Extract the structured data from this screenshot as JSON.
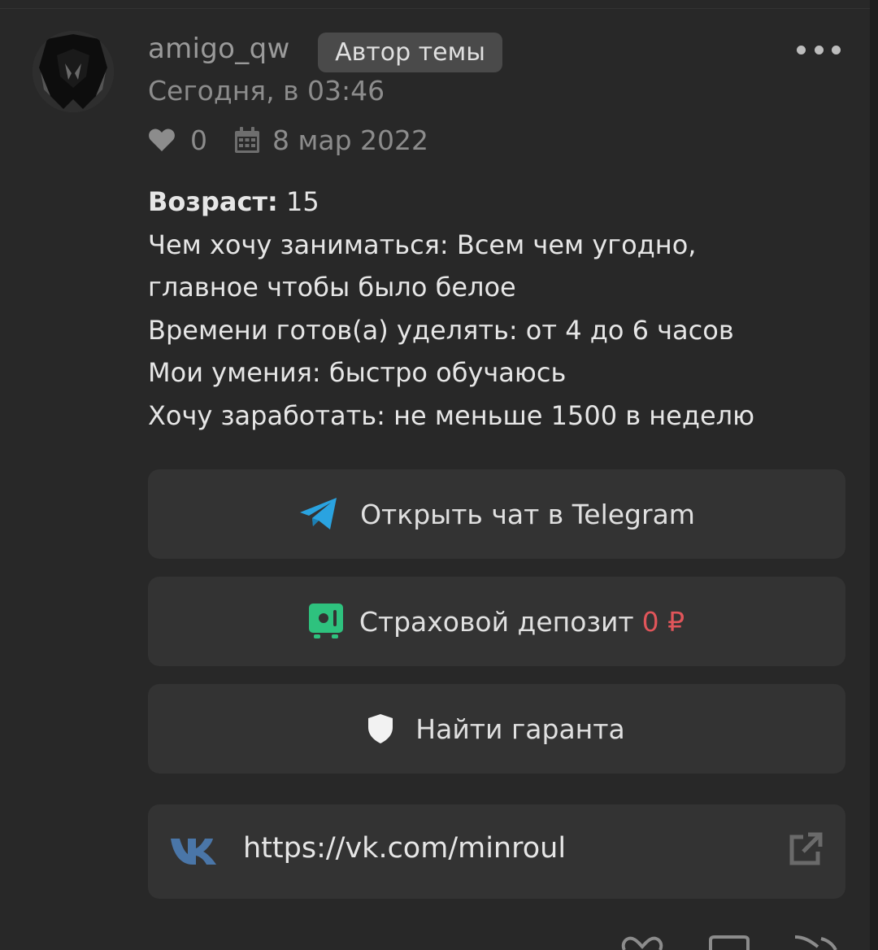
{
  "post": {
    "author": "amigo_qw",
    "author_badge": "Автор темы",
    "time": "Сегодня, в 03:46",
    "likes": "0",
    "reg_date": "8 мар 2022"
  },
  "content": {
    "lines": [
      {
        "key": "Возраст",
        "sep": ":",
        "value": " 15"
      },
      {
        "key": "Чем хочу заниматься: Всем чем угодно,",
        "sep": "",
        "value": ""
      },
      {
        "key": "главное чтобы было белое",
        "sep": "",
        "value": ""
      },
      {
        "key": "Времени готов(а) уделять: от 4 до 6 часов",
        "sep": "",
        "value": ""
      },
      {
        "key": "Мои умения: быстро обучаюсь",
        "sep": "",
        "value": ""
      },
      {
        "key": "Хочу заработать: не меньше 1500 в неделю",
        "sep": "",
        "value": ""
      }
    ]
  },
  "buttons": {
    "telegram": "Открыть чат в Telegram",
    "deposit": "Страховой депозит",
    "deposit_amount": "0 ₽",
    "garant": "Найти гаранта",
    "vk_url": "https://vk.com/minroul"
  },
  "icons": {
    "telegram": "telegram-icon",
    "deposit": "safe-icon",
    "garant": "shield-icon",
    "vk": "vk-icon",
    "external": "external-link-icon",
    "heart": "heart-icon",
    "calendar": "calendar-icon",
    "more": "more-dots-icon"
  },
  "colors": {
    "background": "#282828",
    "button_bg": "#333333",
    "telegram_blue": "#2aa3e0",
    "safe_green": "#2ec27e",
    "deposit_red": "#e0555a",
    "vk_blue": "#4a76a8"
  }
}
